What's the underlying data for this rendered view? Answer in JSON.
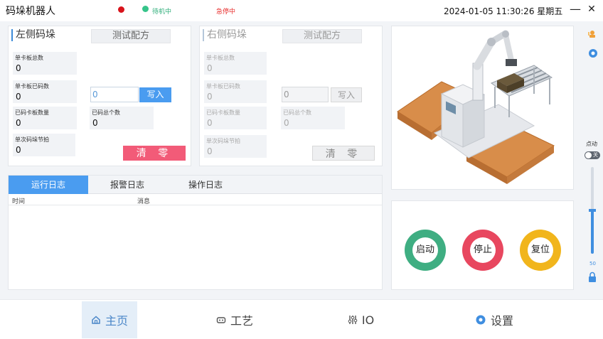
{
  "app": {
    "title": "码垛机器人",
    "status": {
      "standby": "待机中",
      "estop": "急停中"
    },
    "datetime": "2024-01-05 11:30:26 星期五",
    "window": {
      "minimize": "—",
      "close": "✕"
    }
  },
  "left_panel": {
    "title": "左侧码垛",
    "recipe_button": "测试配方",
    "fields": [
      {
        "label": "单卡板总数",
        "value": "0"
      },
      {
        "label": "单卡板已码数",
        "value": "0"
      },
      {
        "label": "已码卡板数量",
        "value": "0"
      },
      {
        "label": "已码总个数",
        "value": "0"
      },
      {
        "label": "单次码垛节拍",
        "value": "0"
      }
    ],
    "input_value": "0",
    "write_button": "写入",
    "clear_button": "清 零"
  },
  "right_panel": {
    "title": "右侧码垛",
    "recipe_button": "测试配方",
    "fields": [
      {
        "label": "单卡板总数",
        "value": "0"
      },
      {
        "label": "单卡板已码数",
        "value": "0"
      },
      {
        "label": "已码卡板数量",
        "value": "0"
      },
      {
        "label": "已码总个数",
        "value": "0"
      },
      {
        "label": "单次码垛节拍",
        "value": "0"
      }
    ],
    "input_value": "0",
    "write_button": "写入",
    "clear_button": "清 零"
  },
  "log": {
    "tabs": [
      "运行日志",
      "报警日志",
      "操作日志"
    ],
    "active_tab": 0,
    "columns": [
      "时间",
      "消息"
    ]
  },
  "controls": {
    "start": "启动",
    "stop": "停止",
    "reset": "复位",
    "colors": {
      "start": "#3fae82",
      "stop": "#e8475f",
      "reset": "#f1b51c"
    }
  },
  "jog": {
    "label": "点动",
    "toggle": "关",
    "speed_value": "50",
    "speed_fraction": 0.5
  },
  "nav": {
    "items": [
      "主页",
      "工艺",
      "IO",
      "设置"
    ],
    "active": 0
  },
  "colors": {
    "accent": "#4a9cf0",
    "danger": "#f25b78"
  }
}
